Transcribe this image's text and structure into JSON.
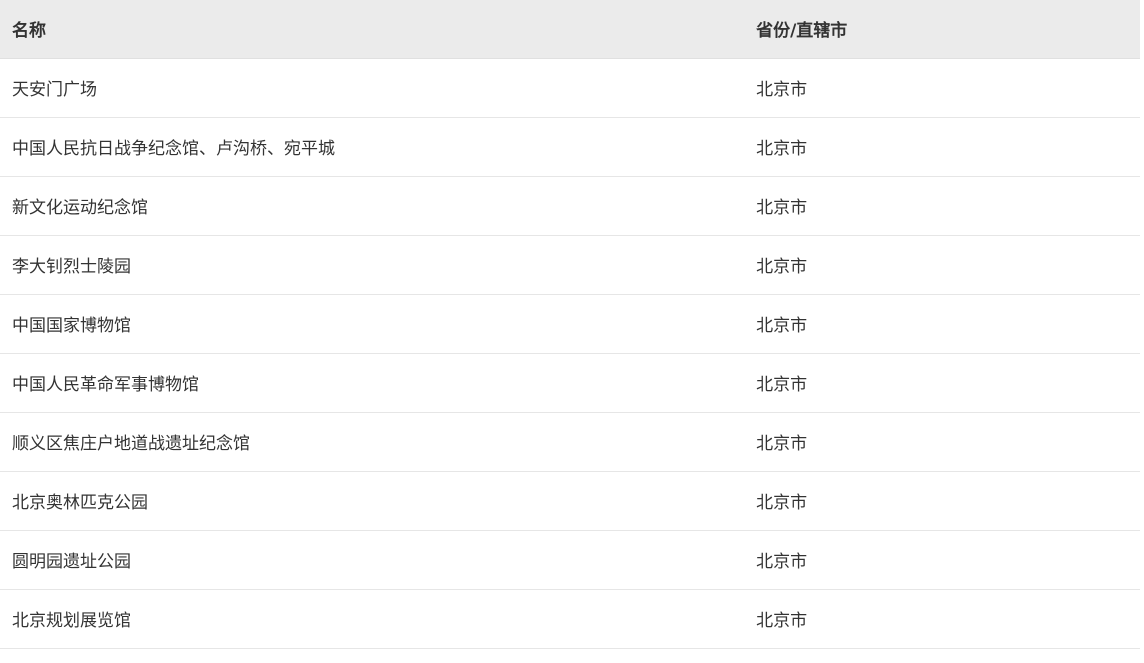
{
  "table": {
    "headers": {
      "name": "名称",
      "province": "省份/直辖市"
    },
    "rows": [
      {
        "name": "天安门广场",
        "province": "北京市"
      },
      {
        "name": "中国人民抗日战争纪念馆、卢沟桥、宛平城",
        "province": "北京市"
      },
      {
        "name": "新文化运动纪念馆",
        "province": "北京市"
      },
      {
        "name": "李大钊烈士陵园",
        "province": "北京市"
      },
      {
        "name": "中国国家博物馆",
        "province": "北京市"
      },
      {
        "name": "中国人民革命军事博物馆",
        "province": "北京市"
      },
      {
        "name": "顺义区焦庄户地道战遗址纪念馆",
        "province": "北京市"
      },
      {
        "name": "北京奥林匹克公园",
        "province": "北京市"
      },
      {
        "name": "圆明园遗址公园",
        "province": "北京市"
      },
      {
        "name": "北京规划展览馆",
        "province": "北京市"
      }
    ]
  }
}
